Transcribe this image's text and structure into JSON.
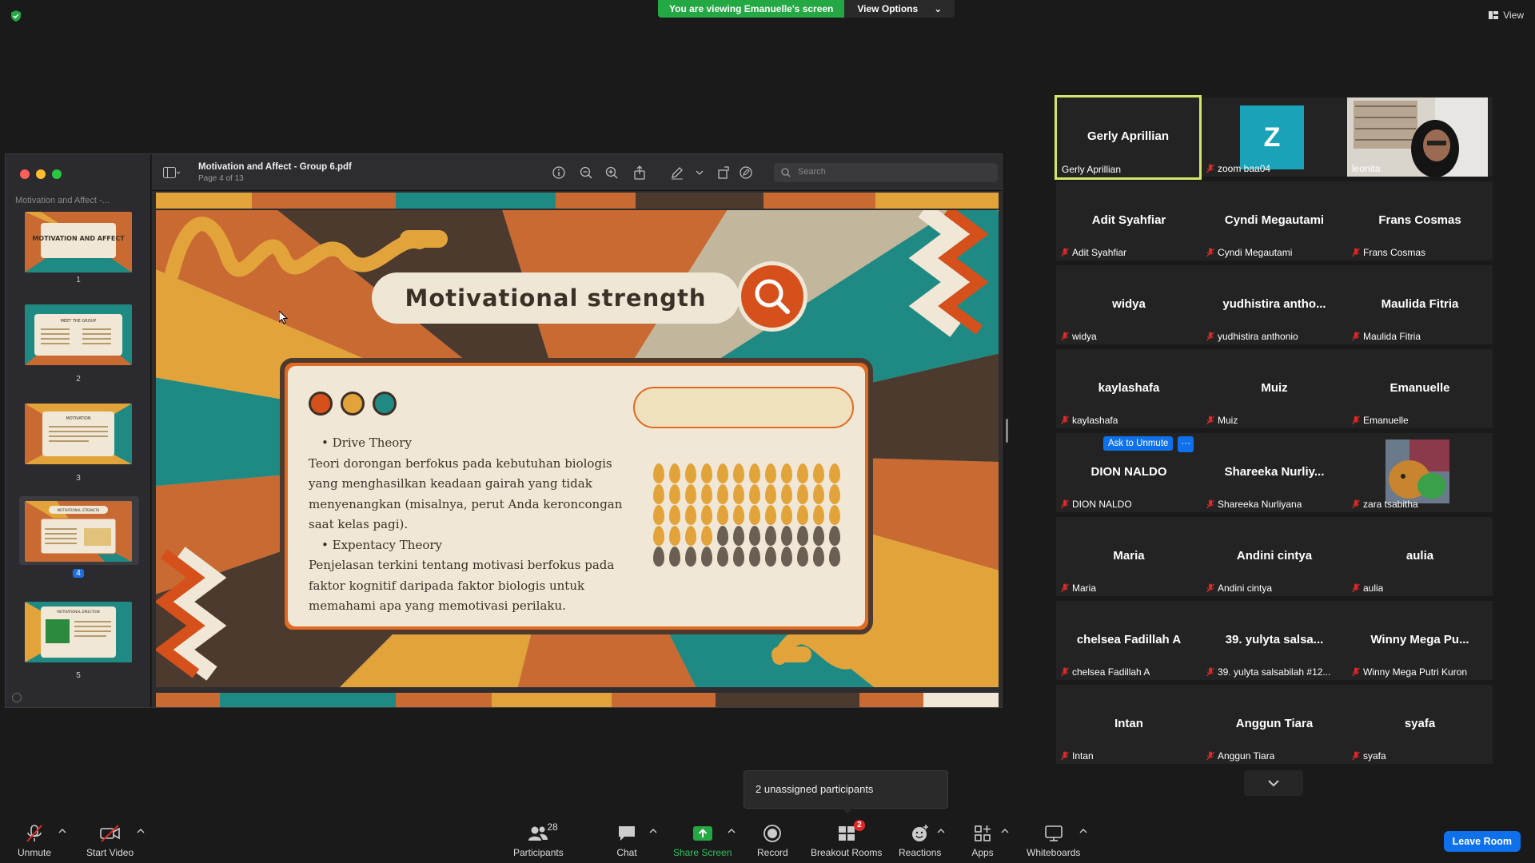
{
  "banner": {
    "viewing_text": "You are viewing Emanuelle's screen",
    "view_options_label": "View Options"
  },
  "top_right": {
    "view_label": "View"
  },
  "pdf": {
    "doc_title": "Motivation and Affect - Group 6.pdf",
    "page_info": "Page 4 of 13",
    "sidebar_title": "Motivation and Affect -...",
    "search_placeholder": "Search",
    "thumbnails": [
      {
        "num": "1",
        "title": "MOTIVATION AND AFFECT"
      },
      {
        "num": "2",
        "title": "MEET THE GROUP"
      },
      {
        "num": "3",
        "title": "MOTIVATION"
      },
      {
        "num": "4",
        "title": "MOTIVATIONAL STRENGTH",
        "selected": true
      },
      {
        "num": "5",
        "title": "MOTIVATIONAL DIRECTION"
      }
    ]
  },
  "slide": {
    "title": "Motivational strength",
    "bullet1": "Drive Theory",
    "para1": "Teori dorongan berfokus pada kebutuhan biologis yang menghasilkan keadaan gairah yang tidak menyenangkan (misalnya, perut Anda keroncongan saat kelas pagi).",
    "bullet2": "Expentacy Theory",
    "para2": "Penjelasan terkini tentang motivasi berfokus pada faktor kognitif daripada faktor biologis untuk memahami apa yang memotivasi perilaku.",
    "colors": {
      "orange": "#d5501a",
      "mustard": "#e2a43a",
      "teal": "#1f8a84",
      "brown": "#4c3a2e",
      "cream": "#f0e7d6"
    }
  },
  "participants": [
    {
      "name": "Gerly Aprillian",
      "label": "Gerly Aprillian",
      "muted": false,
      "active": true
    },
    {
      "name": "",
      "label": "zoom baa04",
      "muted": true,
      "avatar_letter": "Z"
    },
    {
      "name": "",
      "label": "leonita",
      "muted": false,
      "video": true
    },
    {
      "name": "Adit Syahfiar",
      "label": "Adit Syahfiar",
      "muted": true
    },
    {
      "name": "Cyndi Megautami",
      "label": "Cyndi Megautami",
      "muted": true
    },
    {
      "name": "Frans Cosmas",
      "label": "Frans Cosmas",
      "muted": true
    },
    {
      "name": "widya",
      "label": "widya",
      "muted": true
    },
    {
      "name": "yudhistira antho...",
      "label": "yudhistira anthonio",
      "muted": true
    },
    {
      "name": "Maulida Fitria",
      "label": "Maulida Fitria",
      "muted": true
    },
    {
      "name": "kaylashafa",
      "label": "kaylashafa",
      "muted": true
    },
    {
      "name": "Muiz",
      "label": "Muiz",
      "muted": true
    },
    {
      "name": "Emanuelle",
      "label": "Emanuelle",
      "muted": true
    },
    {
      "name": "DION NALDO",
      "label": "DION NALDO",
      "muted": true
    },
    {
      "name": "Shareeka Nurliy...",
      "label": "Shareeka Nurliyana",
      "muted": true
    },
    {
      "name": "",
      "label": "zara tsabitha",
      "muted": true,
      "picture": true
    },
    {
      "name": "Maria",
      "label": "Maria",
      "muted": true
    },
    {
      "name": "Andini cintya",
      "label": "Andini cintya",
      "muted": true
    },
    {
      "name": "aulia",
      "label": "aulia",
      "muted": true
    },
    {
      "name": "chelsea Fadillah A",
      "label": "chelsea Fadillah A",
      "muted": true
    },
    {
      "name": "39. yulyta salsa...",
      "label": "39. yulyta salsabilah #12...",
      "muted": true
    },
    {
      "name": "Winny Mega Pu...",
      "label": "Winny Mega Putri Kuron",
      "muted": true
    },
    {
      "name": "Intan",
      "label": "Intan",
      "muted": true
    },
    {
      "name": "Anggun Tiara",
      "label": "Anggun Tiara",
      "muted": true
    },
    {
      "name": "syafa",
      "label": "syafa",
      "muted": true
    }
  ],
  "ask_unmute": {
    "label": "Ask to Unmute",
    "more": "···"
  },
  "unassigned_tooltip": "2 unassigned participants",
  "toolbar": {
    "unmute": "Unmute",
    "start_video": "Start Video",
    "participants": "Participants",
    "participants_count": "28",
    "chat": "Chat",
    "share_screen": "Share Screen",
    "record": "Record",
    "breakout_rooms": "Breakout Rooms",
    "breakout_badge": "2",
    "reactions": "Reactions",
    "apps": "Apps",
    "whiteboards": "Whiteboards",
    "leave": "Leave Room"
  }
}
